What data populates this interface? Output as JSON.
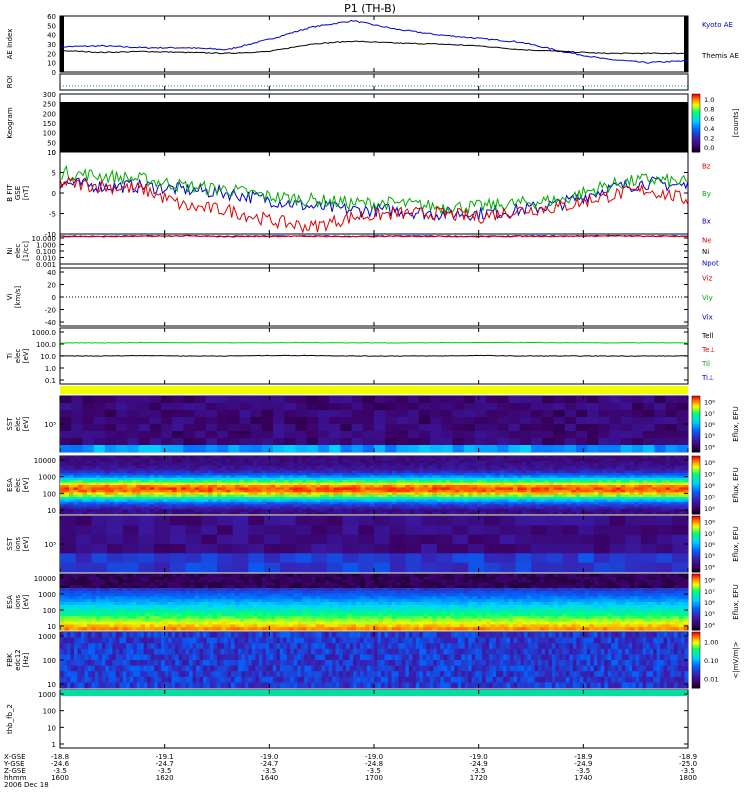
{
  "title": "P1 (TH-B)",
  "x_ticks": [
    "1600",
    "1620",
    "1640",
    "1700",
    "1720",
    "1740",
    "1800"
  ],
  "footer": {
    "row_labels": [
      "X-GSE",
      "Y-GSE",
      "Z-GSE",
      "hhmm",
      "2006 Dec 18"
    ],
    "x_gse": [
      "-18.8",
      "-19.1",
      "-19.0",
      "-19.0",
      "-19.0",
      "-18.9",
      "-18.9"
    ],
    "y_gse": [
      "-24.6",
      "-24.7",
      "-24.7",
      "-24.8",
      "-24.9",
      "-24.9",
      "-25.0"
    ],
    "z_gse": [
      "-3.5",
      "-3.5",
      "-3.5",
      "-3.5",
      "-3.5",
      "-3.5",
      "-3.5"
    ]
  },
  "panels": {
    "ae": {
      "ylabel": "AE Index",
      "ticks": [
        "60",
        "50",
        "40",
        "30",
        "20",
        "10",
        "0"
      ],
      "legend": [
        {
          "text": "Kyoto AE",
          "color": "#0000cc"
        },
        {
          "text": "Themis AE",
          "color": "#000000"
        }
      ]
    },
    "roi": {
      "ylabel": "ROI"
    },
    "keogram": {
      "ylabel": "Keogram",
      "ticks": [
        "300",
        "250",
        "200",
        "150",
        "100",
        "50",
        "0"
      ],
      "cbar_ticks": [
        "1.0",
        "0.8",
        "0.6",
        "0.4",
        "0.2",
        "0.0"
      ],
      "cbar_label": "[counts]"
    },
    "b": {
      "ylabel": [
        "B FIT",
        "GSE",
        "[nT]"
      ],
      "ticks": [
        "10",
        "5",
        "0",
        "-5",
        "-10"
      ],
      "legend": [
        {
          "text": "Bz",
          "color": "#dd0000"
        },
        {
          "text": "By",
          "color": "#00aa00"
        },
        {
          "text": "Bx",
          "color": "#0000cc"
        }
      ]
    },
    "ni": {
      "ylabel": [
        "Ni",
        "elec",
        "[1/cc]"
      ],
      "ticks": [
        "10.000",
        "1.000",
        "0.100",
        "0.010",
        "0.001"
      ],
      "legend": [
        {
          "text": "Ne",
          "color": "#dd0000"
        },
        {
          "text": "Ni",
          "color": "#000000"
        },
        {
          "text": "Npot",
          "color": "#0000cc"
        }
      ]
    },
    "vi": {
      "ylabel": [
        "Vi",
        "[km/s]"
      ],
      "ticks": [
        "40",
        "20",
        "0",
        "-20",
        "-40"
      ],
      "legend": [
        {
          "text": "Viz",
          "color": "#dd0000"
        },
        {
          "text": "Viy",
          "color": "#00aa00"
        },
        {
          "text": "Vix",
          "color": "#0000cc"
        }
      ]
    },
    "ti": {
      "ylabel": [
        "Ti",
        "elec",
        "[eV]"
      ],
      "ticks": [
        "1000.0",
        "100.0",
        "10.0",
        "1.0",
        "0.1"
      ],
      "legend": [
        {
          "text": "Tell",
          "color": "#000000"
        },
        {
          "text": "Te⊥",
          "color": "#dd0000"
        },
        {
          "text": "Til",
          "color": "#00aa00"
        },
        {
          "text": "Ti⊥",
          "color": "#0000cc"
        }
      ]
    },
    "sst_e": {
      "ylabel": [
        "SST",
        "elec",
        "[eV]"
      ],
      "ticks": [
        "10⁵"
      ],
      "cbar_ticks": [
        "10⁸",
        "10⁷",
        "10⁶",
        "10⁵",
        "10⁴"
      ],
      "cbar_label": "Eflux, EFU"
    },
    "esa_e": {
      "ylabel": [
        "ESA",
        "elec",
        "[eV]"
      ],
      "ticks": [
        "10000",
        "1000",
        "100",
        "10"
      ],
      "cbar_ticks": [
        "10⁸",
        "10⁷",
        "10⁶",
        "10⁵",
        "10⁴"
      ],
      "cbar_label": "Eflux, EFU"
    },
    "sst_i": {
      "ylabel": [
        "SST",
        "ions",
        "[eV]"
      ],
      "ticks": [
        "10⁵"
      ],
      "cbar_ticks": [
        "10⁸",
        "10⁷",
        "10⁶",
        "10⁵",
        "10⁴"
      ],
      "cbar_label": "Eflux, EFU"
    },
    "esa_i": {
      "ylabel": [
        "ESA",
        "ions",
        "[eV]"
      ],
      "ticks": [
        "10000",
        "1000",
        "100",
        "10"
      ],
      "cbar_ticks": [
        "10⁸",
        "10⁷",
        "10⁶",
        "10⁵",
        "10⁴"
      ],
      "cbar_label": "Eflux, EFU"
    },
    "fbk": {
      "ylabel": [
        "FBK",
        "edc12",
        "[Hz]"
      ],
      "ticks": [
        "1000",
        "100",
        "10"
      ],
      "cbar_ticks": [
        "1.00",
        "0.10",
        "0.01"
      ],
      "cbar_label": "<|mV/m|>"
    },
    "fb": {
      "ylabel": "thb_fb_2",
      "ticks": [
        "1000",
        "100",
        "10",
        "1"
      ]
    }
  },
  "chart_data": {
    "type": "line",
    "title": "P1 (TH-B)",
    "x": [
      "1600",
      "1610",
      "1620",
      "1630",
      "1640",
      "1645",
      "1650",
      "1655",
      "1700",
      "1705",
      "1710",
      "1720",
      "1730",
      "1740",
      "1750",
      "1800"
    ],
    "series": [
      {
        "name": "Kyoto AE",
        "values": [
          27,
          28,
          26,
          26,
          24,
          35,
          48,
          55,
          46,
          40,
          36,
          32,
          22,
          14,
          10,
          12
        ]
      },
      {
        "name": "Themis AE",
        "values": [
          23,
          21,
          22,
          21,
          20,
          22,
          30,
          33,
          31,
          30,
          28,
          24,
          22,
          20,
          20,
          20
        ]
      },
      {
        "name": "Bz",
        "values": [
          3,
          2,
          1,
          -4,
          -5,
          -8,
          -10,
          -7,
          -6,
          -6,
          -7,
          -5,
          -4,
          -1,
          1,
          -2
        ]
      },
      {
        "name": "By",
        "values": [
          6,
          5,
          4,
          2,
          1,
          -1,
          -2,
          -3,
          -3,
          -4,
          -4,
          -3,
          -2,
          2,
          4,
          3
        ]
      },
      {
        "name": "Bx",
        "values": [
          3,
          2,
          2,
          1,
          0,
          -2,
          -4,
          -5,
          -5,
          -6,
          -6,
          -5,
          -3,
          1,
          3,
          2
        ]
      },
      {
        "name": "Til",
        "values": [
          120,
          125,
          130,
          130,
          125,
          128,
          130,
          126,
          124,
          128,
          130,
          132,
          128,
          125,
          126,
          124
        ]
      },
      {
        "name": "Tell",
        "values": [
          10,
          10,
          11,
          10,
          10,
          11,
          11,
          10,
          10,
          10,
          11,
          10,
          10,
          10,
          10,
          10
        ]
      }
    ]
  }
}
